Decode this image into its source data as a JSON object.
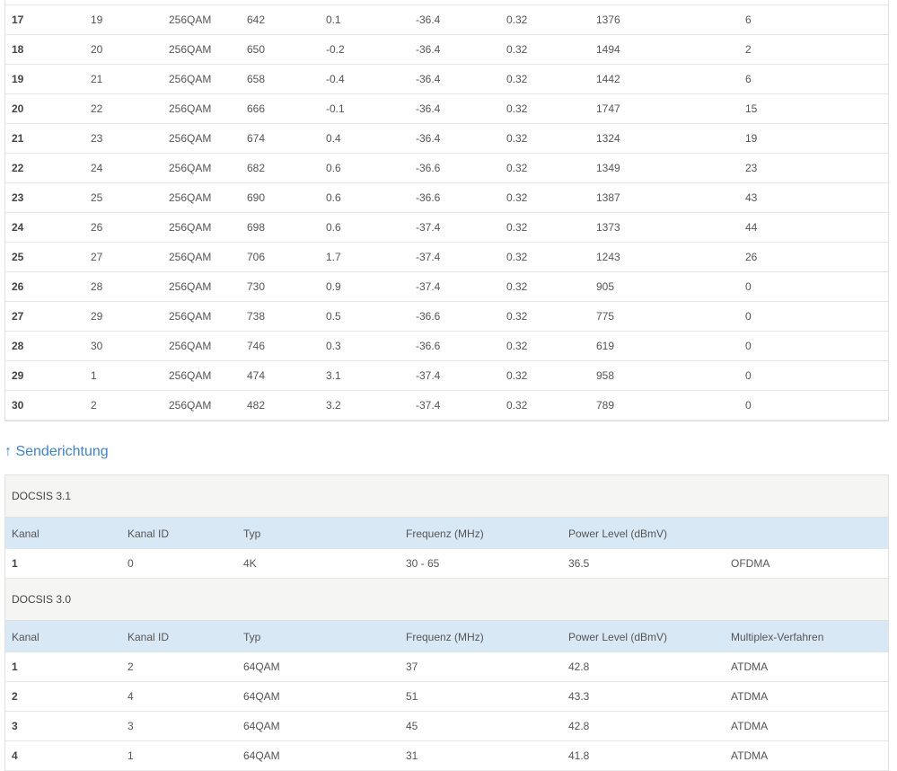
{
  "downstream_rows": [
    [
      "",
      "",
      "",
      "",
      "",
      "",
      "",
      "",
      ""
    ],
    [
      "17",
      "19",
      "256QAM",
      "642",
      "0.1",
      "-36.4",
      "0.32",
      "1376",
      "6"
    ],
    [
      "18",
      "20",
      "256QAM",
      "650",
      "-0.2",
      "-36.4",
      "0.32",
      "1494",
      "2"
    ],
    [
      "19",
      "21",
      "256QAM",
      "658",
      "-0.4",
      "-36.4",
      "0.32",
      "1442",
      "6"
    ],
    [
      "20",
      "22",
      "256QAM",
      "666",
      "-0.1",
      "-36.4",
      "0.32",
      "1747",
      "15"
    ],
    [
      "21",
      "23",
      "256QAM",
      "674",
      "0.4",
      "-36.4",
      "0.32",
      "1324",
      "19"
    ],
    [
      "22",
      "24",
      "256QAM",
      "682",
      "0.6",
      "-36.6",
      "0.32",
      "1349",
      "23"
    ],
    [
      "23",
      "25",
      "256QAM",
      "690",
      "0.6",
      "-36.6",
      "0.32",
      "1387",
      "43"
    ],
    [
      "24",
      "26",
      "256QAM",
      "698",
      "0.6",
      "-37.4",
      "0.32",
      "1373",
      "44"
    ],
    [
      "25",
      "27",
      "256QAM",
      "706",
      "1.7",
      "-37.4",
      "0.32",
      "1243",
      "26"
    ],
    [
      "26",
      "28",
      "256QAM",
      "730",
      "0.9",
      "-37.4",
      "0.32",
      "905",
      "0"
    ],
    [
      "27",
      "29",
      "256QAM",
      "738",
      "0.5",
      "-36.6",
      "0.32",
      "775",
      "0"
    ],
    [
      "28",
      "30",
      "256QAM",
      "746",
      "0.3",
      "-36.6",
      "0.32",
      "619",
      "0"
    ],
    [
      "29",
      "1",
      "256QAM",
      "474",
      "3.1",
      "-37.4",
      "0.32",
      "958",
      "0"
    ],
    [
      "30",
      "2",
      "256QAM",
      "482",
      "3.2",
      "-37.4",
      "0.32",
      "789",
      "0"
    ]
  ],
  "upstream": {
    "title": "↑ Senderichtung",
    "docsis31": {
      "label": "DOCSIS 3.1",
      "headers": [
        "Kanal",
        "Kanal ID",
        "Typ",
        "Frequenz (MHz)",
        "Power Level (dBmV)",
        ""
      ],
      "rows": [
        [
          "1",
          "0",
          "4K",
          "30 - 65",
          "36.5",
          "OFDMA"
        ]
      ]
    },
    "docsis30": {
      "label": "DOCSIS 3.0",
      "headers": [
        "Kanal",
        "Kanal ID",
        "Typ",
        "Frequenz (MHz)",
        "Power Level (dBmV)",
        "Multiplex-Verfahren"
      ],
      "rows": [
        [
          "1",
          "2",
          "64QAM",
          "37",
          "42.8",
          "ATDMA"
        ],
        [
          "2",
          "4",
          "64QAM",
          "51",
          "43.3",
          "ATDMA"
        ],
        [
          "3",
          "3",
          "64QAM",
          "45",
          "42.8",
          "ATDMA"
        ],
        [
          "4",
          "1",
          "64QAM",
          "31",
          "41.8",
          "ATDMA"
        ]
      ]
    }
  }
}
